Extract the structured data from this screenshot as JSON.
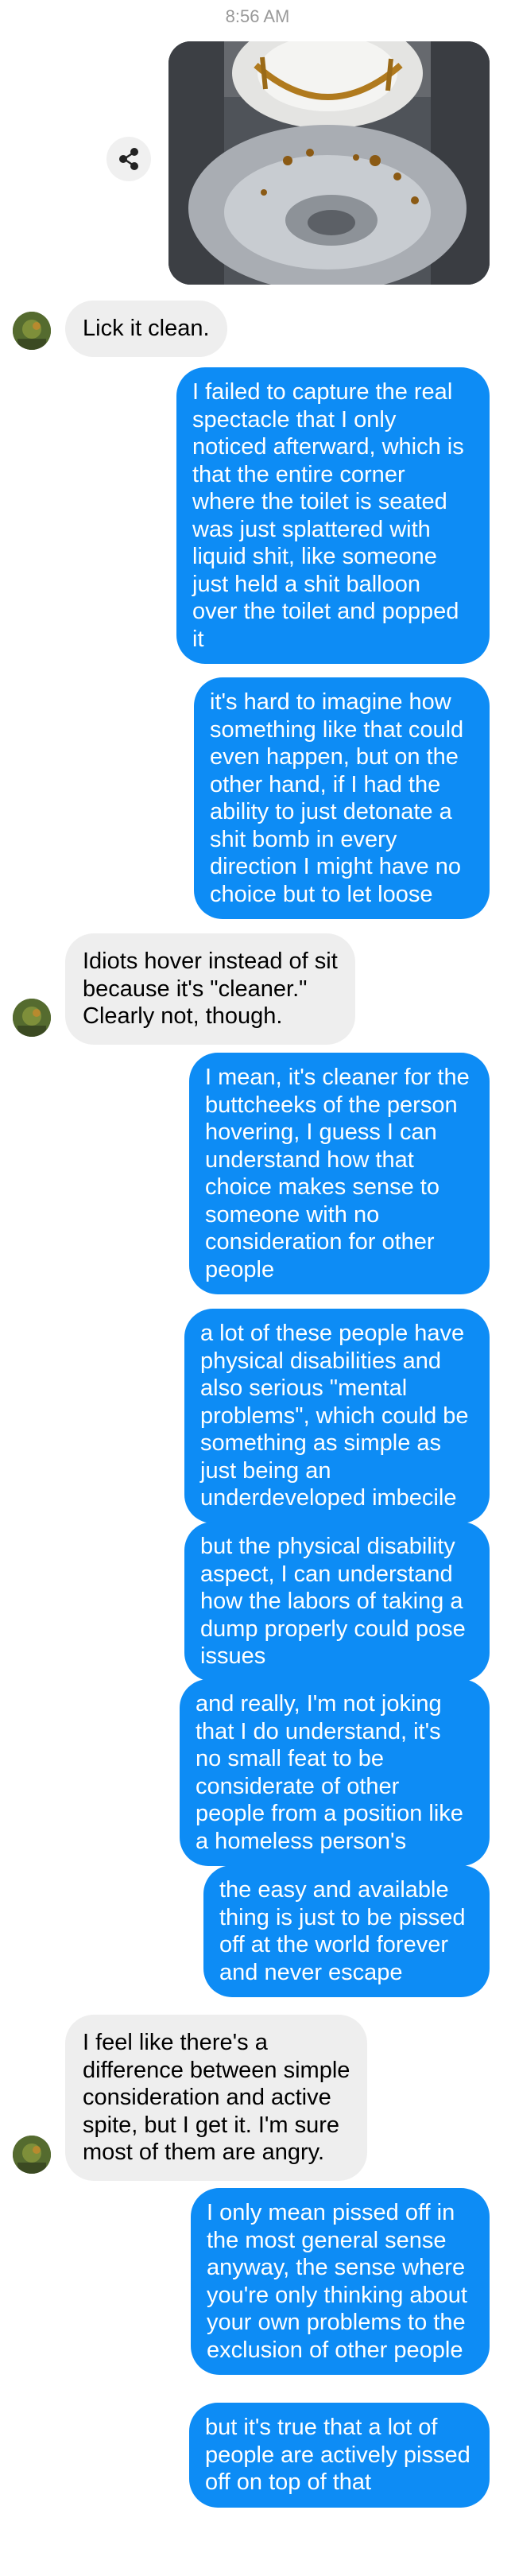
{
  "timestamp": "8:56 AM",
  "icons": {
    "share": "share-icon"
  },
  "colors": {
    "sent_bubble": "#0d8cf5",
    "received_bubble": "#eeeeee",
    "timestamp_text": "#999999"
  },
  "messages": [
    {
      "sender": "them",
      "text": "Lick it clean."
    },
    {
      "sender": "me",
      "text": "I failed to capture the real\nspectacle that I only\nnoticed afterward, which is\nthat the entire corner\nwhere the toilet is seated\nwas just splattered with\nliquid shit, like someone\njust held a shit balloon\nover the toilet and popped\nit"
    },
    {
      "sender": "me",
      "text": "it's hard to imagine how\nsomething like that could\neven happen, but on the\nother hand, if I had the\nability to just detonate a\nshit bomb in every\ndirection I might have no\nchoice but to let loose"
    },
    {
      "sender": "them",
      "text": "Idiots hover instead of sit\nbecause it's \"cleaner.\"\nClearly not, though."
    },
    {
      "sender": "me",
      "text": "I mean, it's cleaner for the\nbuttcheeks of the person\nhovering, I guess I can\nunderstand how that\nchoice makes sense to\nsomeone with no\nconsideration for other\npeople"
    },
    {
      "sender": "me",
      "text": "a lot of these people have\nphysical disabilities and\nalso serious \"mental\nproblems\", which could be\nsomething as simple as\njust being an\nunderdeveloped imbecile"
    },
    {
      "sender": "me",
      "text": "but the physical disability\naspect, I can understand\nhow the labors of taking a\ndump properly could pose\nissues"
    },
    {
      "sender": "me",
      "text": "and really, I'm not joking\nthat I do understand, it's\nno small feat to be\nconsiderate of other\npeople from a position like\na homeless person's"
    },
    {
      "sender": "me",
      "text": "the easy and available\nthing is just to be pissed\noff at the world forever\nand never escape"
    },
    {
      "sender": "them",
      "text": "I feel like there's a\ndifference between simple\nconsideration and active\nspite, but I get it. I'm sure\nmost of them are angry."
    },
    {
      "sender": "me",
      "text": "I only mean pissed off in\nthe most general sense\nanyway, the sense where\nyou're only thinking about\nyour own problems to the\nexclusion of other people"
    },
    {
      "sender": "me",
      "text": "but it's true that a lot of\npeople are actively pissed\noff on top of that"
    }
  ]
}
